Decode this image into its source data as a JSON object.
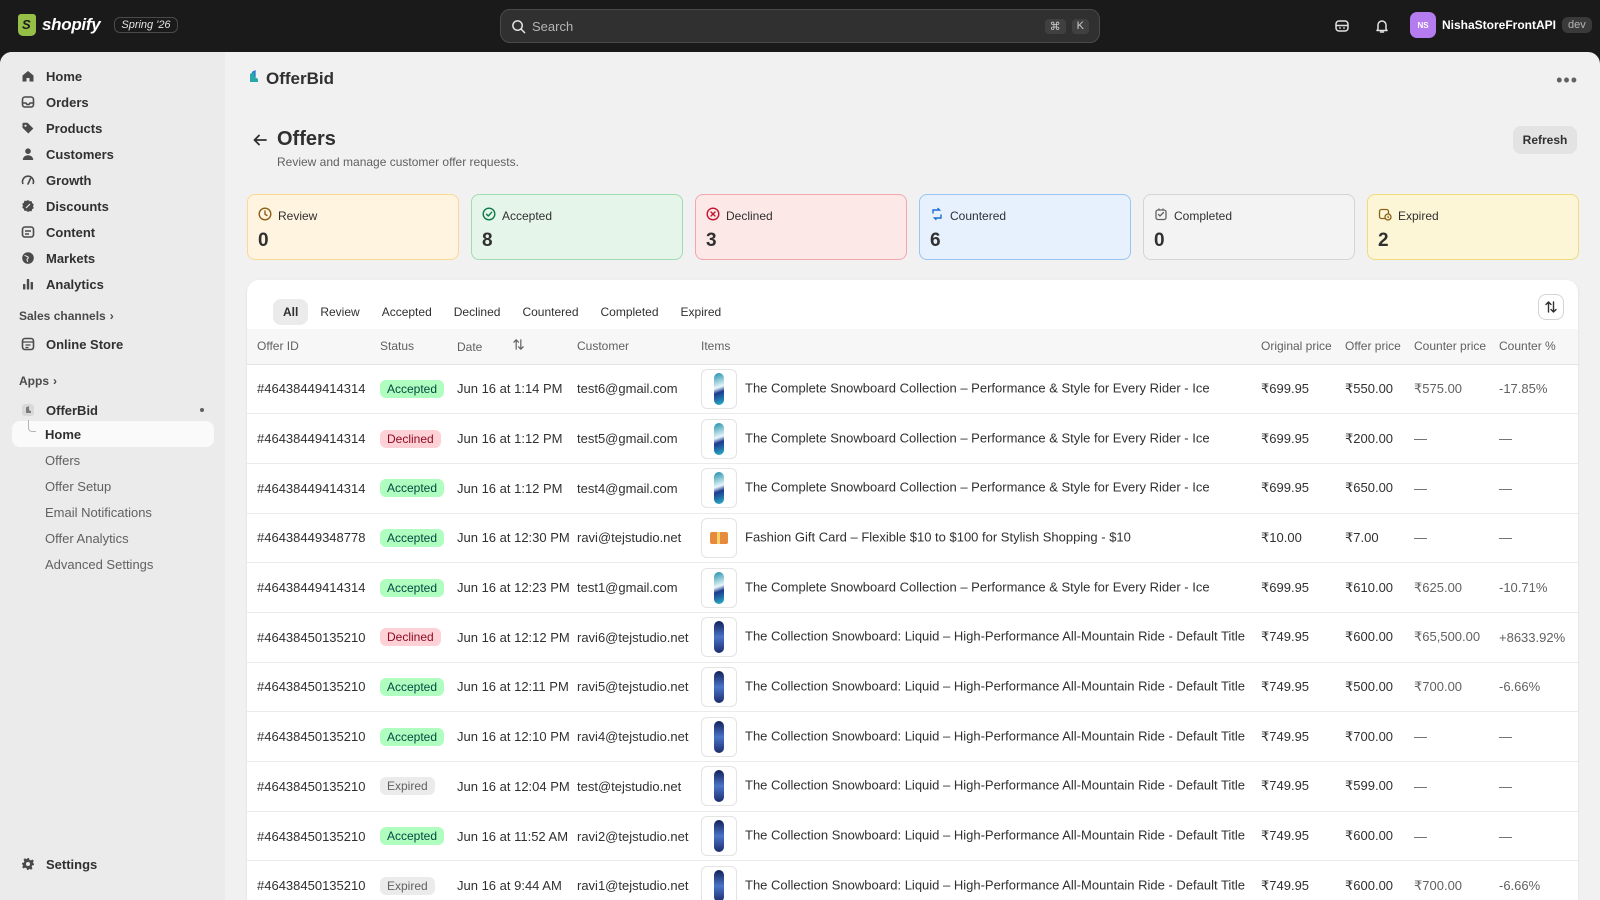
{
  "topbar": {
    "brand": "shopify",
    "edition": "Spring '26",
    "search_placeholder": "Search",
    "shortcut_keys": [
      "⌘",
      "K"
    ],
    "store_initials": "NS",
    "store_name": "NishaStoreFrontAPI",
    "store_badge": "dev"
  },
  "sidebar": {
    "main_items": [
      {
        "label": "Home",
        "icon": "home-icon"
      },
      {
        "label": "Orders",
        "icon": "orders-icon"
      },
      {
        "label": "Products",
        "icon": "tag-icon"
      },
      {
        "label": "Customers",
        "icon": "person-icon"
      },
      {
        "label": "Growth",
        "icon": "growth-icon"
      },
      {
        "label": "Discounts",
        "icon": "discount-icon"
      },
      {
        "label": "Content",
        "icon": "content-icon"
      },
      {
        "label": "Markets",
        "icon": "globe-icon"
      },
      {
        "label": "Analytics",
        "icon": "bar-chart-icon"
      }
    ],
    "sales_channels_label": "Sales channels",
    "online_store_label": "Online Store",
    "apps_label": "Apps",
    "app_name": "OfferBid",
    "app_sub_items": [
      "Home",
      "Offers",
      "Offer Setup",
      "Email Notifications",
      "Offer Analytics",
      "Advanced Settings"
    ],
    "settings_label": "Settings"
  },
  "header": {
    "app_title": "OfferBid",
    "page_title": "Offers",
    "page_subtitle": "Review and manage customer offer requests.",
    "refresh_label": "Refresh"
  },
  "stats": [
    {
      "label": "Review",
      "value": "0",
      "bg": "#fff4e0",
      "border": "#fcd896",
      "icon": "clock-icon"
    },
    {
      "label": "Accepted",
      "value": "8",
      "bg": "#e6f5ea",
      "border": "#9fdcb2",
      "icon": "check-circle-icon"
    },
    {
      "label": "Declined",
      "value": "3",
      "bg": "#fde8e8",
      "border": "#f3a6ae",
      "icon": "x-circle-icon"
    },
    {
      "label": "Countered",
      "value": "6",
      "bg": "#e6f1fd",
      "border": "#99c6f2",
      "icon": "arrows-icon"
    },
    {
      "label": "Completed",
      "value": "0",
      "bg": "#f3f3f3",
      "border": "#d4d4d4",
      "icon": "checklist-icon"
    },
    {
      "label": "Expired",
      "value": "2",
      "bg": "#fdf6d6",
      "border": "#f0db7d",
      "icon": "calendar-clock-icon"
    }
  ],
  "tabs": [
    "All",
    "Review",
    "Accepted",
    "Declined",
    "Countered",
    "Completed",
    "Expired"
  ],
  "table": {
    "columns": [
      "Offer ID",
      "Status",
      "Date",
      "Customer",
      "Items",
      "Original price",
      "Offer price",
      "Counter price",
      "Counter %"
    ],
    "rows": [
      {
        "id": "#46438449414314",
        "status": "Accepted",
        "date": "Jun 16 at 1:14 PM",
        "customer": "test6@gmail.com",
        "thumb": "ice",
        "item": "The Complete Snowboard Collection – Performance & Style for Every Rider - Ice",
        "original": "₹699.95",
        "offer": "₹550.00",
        "counter": "₹575.00",
        "counter_pct": "-17.85%"
      },
      {
        "id": "#46438449414314",
        "status": "Declined",
        "date": "Jun 16 at 1:12 PM",
        "customer": "test5@gmail.com",
        "thumb": "ice",
        "item": "The Complete Snowboard Collection – Performance & Style for Every Rider - Ice",
        "original": "₹699.95",
        "offer": "₹200.00",
        "counter": "—",
        "counter_pct": "—"
      },
      {
        "id": "#46438449414314",
        "status": "Accepted",
        "date": "Jun 16 at 1:12 PM",
        "customer": "test4@gmail.com",
        "thumb": "ice",
        "item": "The Complete Snowboard Collection – Performance & Style for Every Rider - Ice",
        "original": "₹699.95",
        "offer": "₹650.00",
        "counter": "—",
        "counter_pct": "—"
      },
      {
        "id": "#46438449348778",
        "status": "Accepted",
        "date": "Jun 16 at 12:30 PM",
        "customer": "ravi@tejstudio.net",
        "thumb": "gift",
        "item": "Fashion Gift Card – Flexible $10 to $100 for Stylish Shopping - $10",
        "original": "₹10.00",
        "offer": "₹7.00",
        "counter": "—",
        "counter_pct": "—"
      },
      {
        "id": "#46438449414314",
        "status": "Accepted",
        "date": "Jun 16 at 12:23 PM",
        "customer": "test1@gmail.com",
        "thumb": "ice",
        "item": "The Complete Snowboard Collection – Performance & Style for Every Rider - Ice",
        "original": "₹699.95",
        "offer": "₹610.00",
        "counter": "₹625.00",
        "counter_pct": "-10.71%"
      },
      {
        "id": "#46438450135210",
        "status": "Declined",
        "date": "Jun 16 at 12:12 PM",
        "customer": "ravi6@tejstudio.net",
        "thumb": "liquid",
        "item": "The Collection Snowboard: Liquid – High-Performance All-Mountain Ride - Default Title",
        "original": "₹749.95",
        "offer": "₹600.00",
        "counter": "₹65,500.00",
        "counter_pct": "+8633.92%"
      },
      {
        "id": "#46438450135210",
        "status": "Accepted",
        "date": "Jun 16 at 12:11 PM",
        "customer": "ravi5@tejstudio.net",
        "thumb": "liquid",
        "item": "The Collection Snowboard: Liquid – High-Performance All-Mountain Ride - Default Title",
        "original": "₹749.95",
        "offer": "₹500.00",
        "counter": "₹700.00",
        "counter_pct": "-6.66%"
      },
      {
        "id": "#46438450135210",
        "status": "Accepted",
        "date": "Jun 16 at 12:10 PM",
        "customer": "ravi4@tejstudio.net",
        "thumb": "liquid",
        "item": "The Collection Snowboard: Liquid – High-Performance All-Mountain Ride - Default Title",
        "original": "₹749.95",
        "offer": "₹700.00",
        "counter": "—",
        "counter_pct": "—"
      },
      {
        "id": "#46438450135210",
        "status": "Expired",
        "date": "Jun 16 at 12:04 PM",
        "customer": "test@tejstudio.net",
        "thumb": "liquid",
        "item": "The Collection Snowboard: Liquid – High-Performance All-Mountain Ride - Default Title",
        "original": "₹749.95",
        "offer": "₹599.00",
        "counter": "—",
        "counter_pct": "—"
      },
      {
        "id": "#46438450135210",
        "status": "Accepted",
        "date": "Jun 16 at 11:52 AM",
        "customer": "ravi2@tejstudio.net",
        "thumb": "liquid",
        "item": "The Collection Snowboard: Liquid – High-Performance All-Mountain Ride - Default Title",
        "original": "₹749.95",
        "offer": "₹600.00",
        "counter": "—",
        "counter_pct": "—"
      },
      {
        "id": "#46438450135210",
        "status": "Expired",
        "date": "Jun 16 at 9:44 AM",
        "customer": "ravi1@tejstudio.net",
        "thumb": "liquid",
        "item": "The Collection Snowboard: Liquid – High-Performance All-Mountain Ride - Default Title",
        "original": "₹749.95",
        "offer": "₹600.00",
        "counter": "₹700.00",
        "counter_pct": "-6.66%"
      }
    ]
  }
}
